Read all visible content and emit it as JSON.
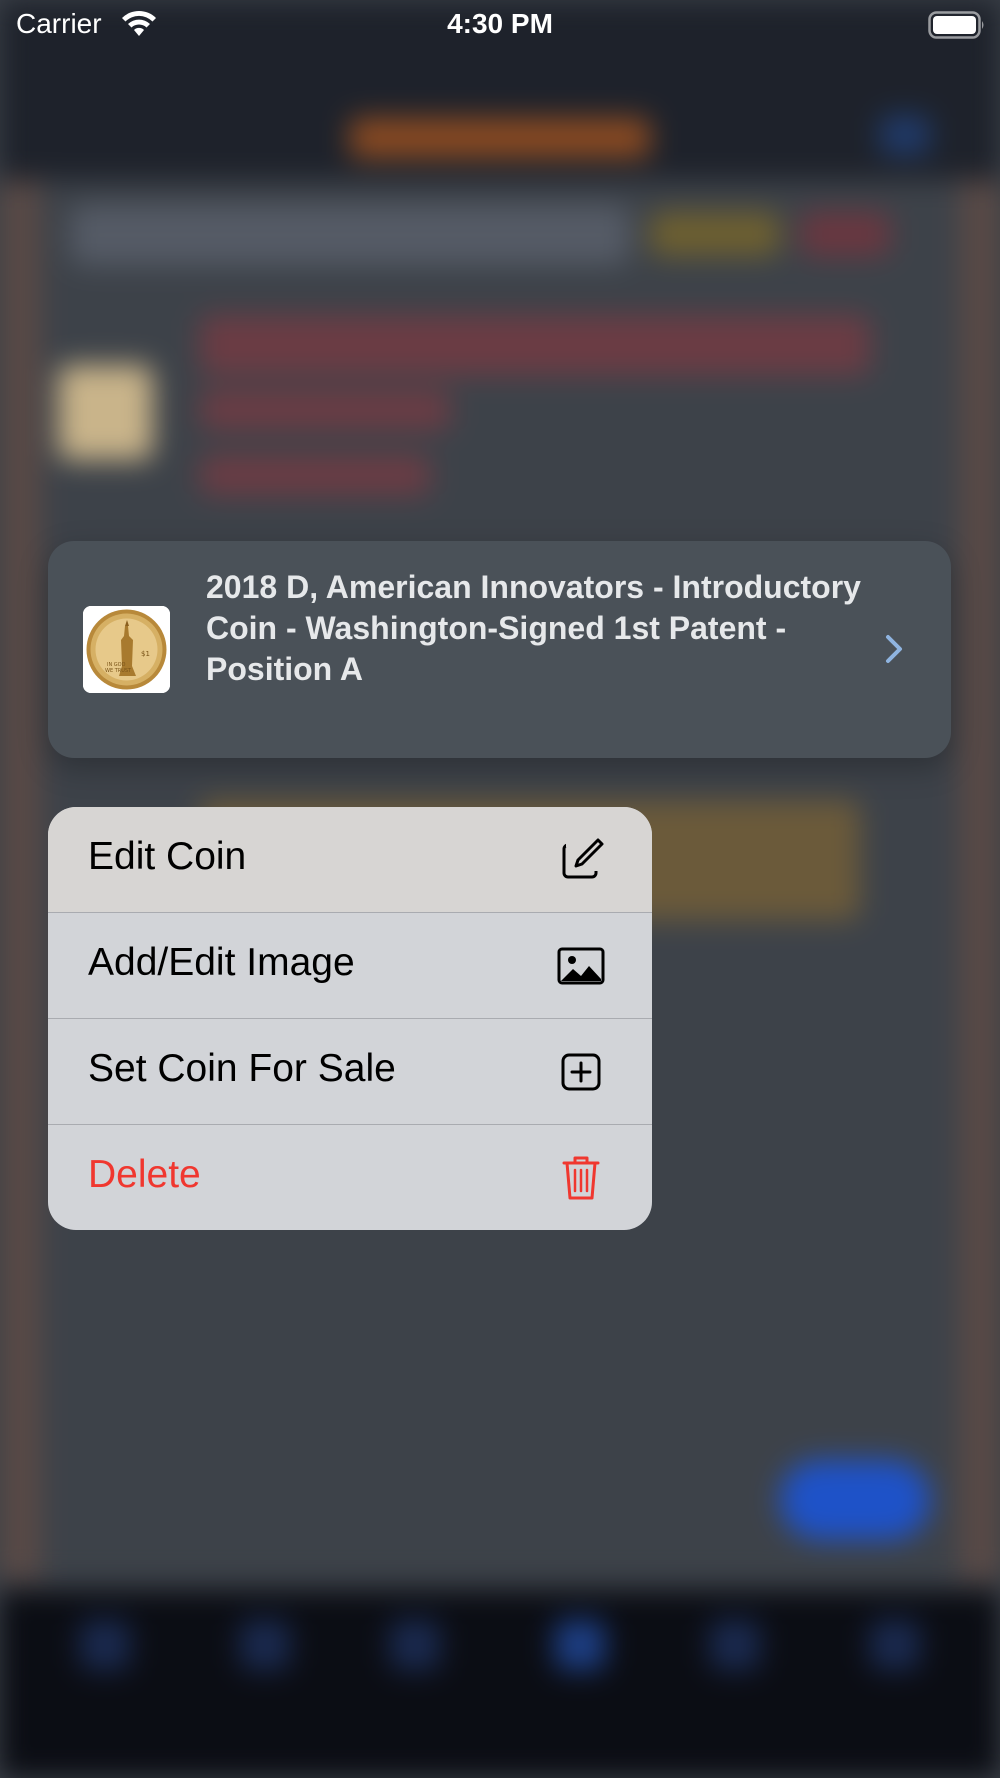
{
  "status_bar": {
    "carrier": "Carrier",
    "time": "4:30 PM",
    "wifi_icon": "wifi-icon",
    "battery_icon": "battery-full-icon"
  },
  "preview_card": {
    "title": "2018 D, American Innovators - Introductory Coin - Washington-Signed 1st Patent - Position A",
    "thumbnail_icon": "coin-image",
    "chevron_icon": "chevron-right-icon"
  },
  "context_menu": {
    "items": [
      {
        "label": "Edit Coin",
        "icon": "square-pencil-icon",
        "destructive": false
      },
      {
        "label": "Add/Edit Image",
        "icon": "photo-icon",
        "destructive": false
      },
      {
        "label": "Set Coin For Sale",
        "icon": "plus-square-icon",
        "destructive": false
      },
      {
        "label": "Delete",
        "icon": "trash-icon",
        "destructive": true
      }
    ]
  },
  "colors": {
    "destructive": "#f0372f",
    "menu_background": "#d2d4d8",
    "card_background": "#4a5158",
    "chevron": "#8fb4e0"
  }
}
